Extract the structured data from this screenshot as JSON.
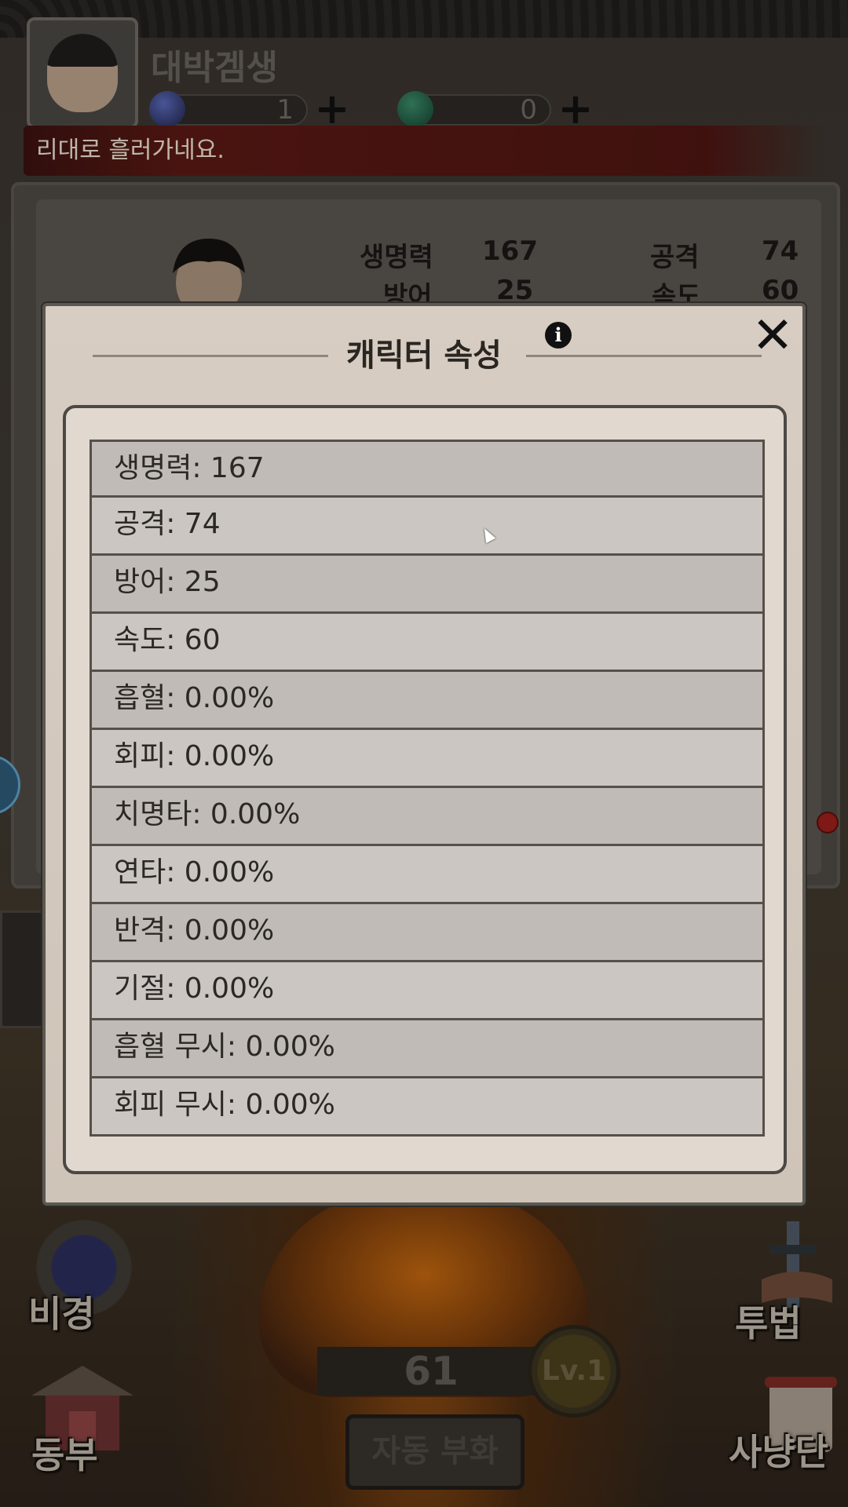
{
  "player": {
    "name": "대박겜생",
    "gems": "1",
    "coins": "0"
  },
  "ticker": {
    "text": "리대로 흘러가네요."
  },
  "char_stats_bg": {
    "hp_label": "생명력",
    "hp_value": "167",
    "atk_label": "공격",
    "atk_value": "74",
    "def_label": "방어",
    "def_value": "25",
    "spd_label": "속도",
    "spd_value": "60"
  },
  "modal": {
    "title": "캐릭터 속성",
    "info_icon": "i",
    "close_icon": "✕",
    "stats": [
      "생명력: 167",
      "공격: 74",
      "방어: 25",
      "속도: 60",
      "흡혈: 0.00%",
      "회피: 0.00%",
      "치명타: 0.00%",
      "연타: 0.00%",
      "반격: 0.00%",
      "기절: 0.00%",
      "흡혈 무시: 0.00%",
      "회피 무시: 0.00%"
    ]
  },
  "menu": {
    "bikyung": "비경",
    "dongbu": "동부",
    "tubeop": "투법",
    "sanyangdan": "사냥단"
  },
  "bottom": {
    "counter": "61",
    "level": "Lv.1",
    "auto_button": "자동 부화"
  },
  "colors": {
    "modal_bg": "#d7cdc3",
    "row_odd": "#c0bbb6",
    "row_even": "#cbc6c1",
    "ticker_bg": "#5a1914"
  }
}
